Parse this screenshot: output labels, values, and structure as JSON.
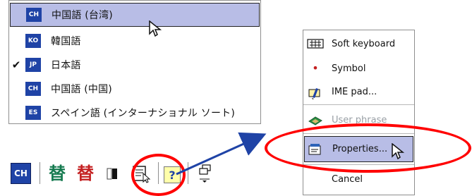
{
  "language_menu": {
    "items": [
      {
        "code": "CH",
        "label": "中国語 (台湾)",
        "checked": false,
        "selected": true
      },
      {
        "code": "KO",
        "label": "韓国語",
        "checked": false,
        "selected": false
      },
      {
        "code": "JP",
        "label": "日本語",
        "checked": true,
        "selected": false
      },
      {
        "code": "CH",
        "label": "中国語 (中国)",
        "checked": false,
        "selected": false
      },
      {
        "code": "ES",
        "label": "スペイン語 (インターナショナル ソート)",
        "checked": false,
        "selected": false
      }
    ],
    "check_mark": "✔"
  },
  "taskbar": {
    "language_code": "CH",
    "glyph_primary": "替",
    "glyph_secondary": "替",
    "help_icon": "?"
  },
  "context_menu": {
    "items": [
      {
        "label": "Soft keyboard",
        "disabled": false,
        "selected": false,
        "icon": "keyboard-icon"
      },
      {
        "label": "Symbol",
        "disabled": false,
        "selected": false,
        "icon": "symbol-icon"
      },
      {
        "label": "IME pad...",
        "disabled": false,
        "selected": false,
        "icon": "ime-pad-icon"
      },
      {
        "label": "User phrase",
        "disabled": true,
        "selected": false,
        "icon": "user-phrase-icon"
      },
      {
        "label": "Properties...",
        "disabled": false,
        "selected": true,
        "icon": "properties-icon"
      },
      {
        "label": "Cancel",
        "disabled": false,
        "selected": false,
        "icon": ""
      }
    ]
  },
  "colors": {
    "selection": "#b8bde6",
    "badge_blue": "#1f43a6",
    "highlight_red": "#ff0000",
    "disabled_text": "#9aa0a6",
    "glyph_green": "#157a4f",
    "glyph_red": "#c42021"
  }
}
